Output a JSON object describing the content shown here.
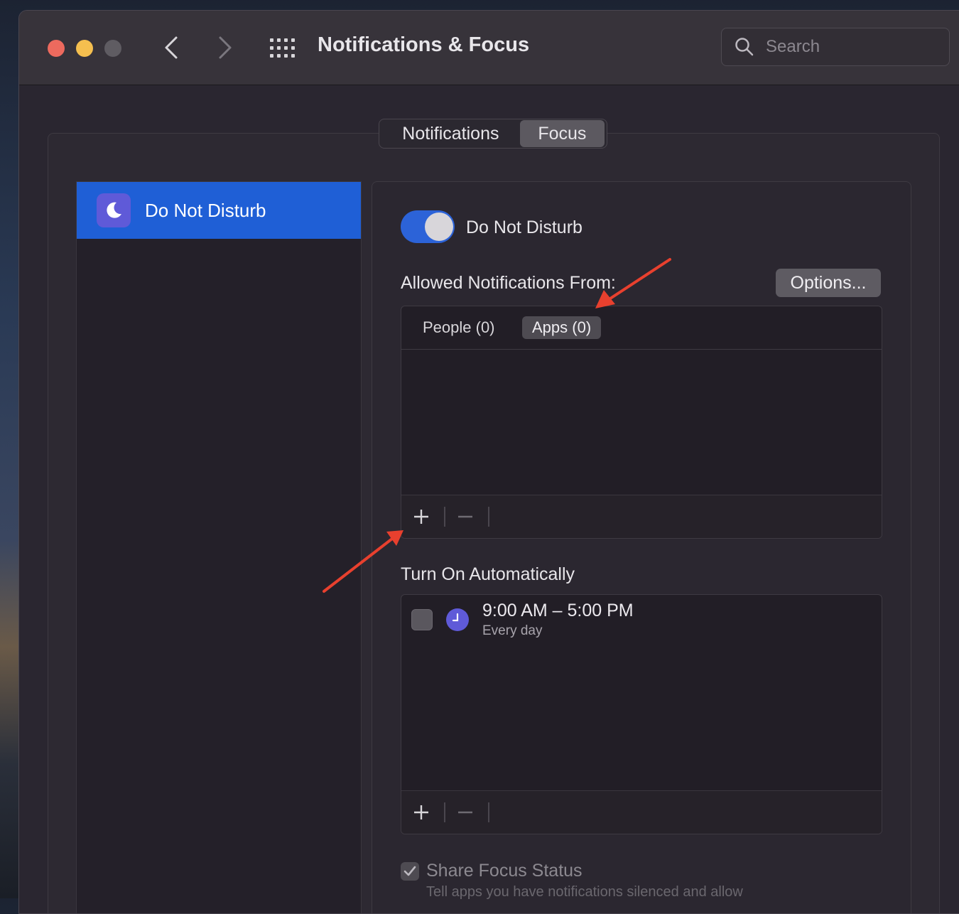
{
  "window": {
    "title": "Notifications & Focus",
    "search_placeholder": "Search"
  },
  "tabs": {
    "notifications_label": "Notifications",
    "focus_label": "Focus",
    "active": "Focus"
  },
  "sidebar": {
    "items": [
      {
        "label": "Do Not Disturb",
        "icon": "moon-icon",
        "selected": true
      }
    ]
  },
  "focus": {
    "toggle_label": "Do Not Disturb",
    "toggle_on": true,
    "allowed_label": "Allowed Notifications From:",
    "options_label": "Options...",
    "subtabs": {
      "people": "People (0)",
      "apps": "Apps (0)",
      "active": "Apps (0)"
    },
    "add_symbol": "+",
    "remove_symbol": "−",
    "turn_on_label": "Turn On Automatically",
    "schedule": {
      "time": "9:00 AM – 5:00 PM",
      "repeat": "Every day",
      "enabled": false
    },
    "share_label": "Share Focus Status",
    "share_checked": true,
    "share_description": "Tell apps you have notifications silenced and allow"
  },
  "colors": {
    "accent": "#1f5fd6",
    "toggle_on": "#2c63d8",
    "focus_tile": "#5f5ad8",
    "annotation_arrow": "#e8402e"
  }
}
